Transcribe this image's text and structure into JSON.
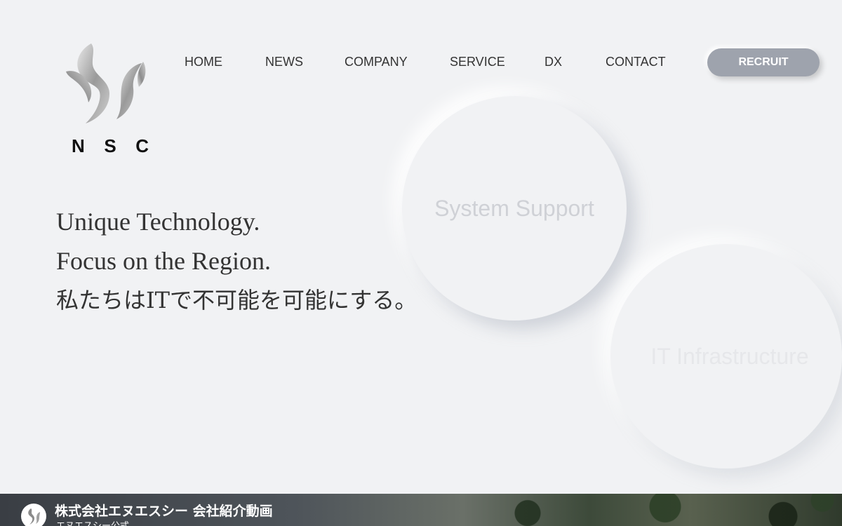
{
  "brand": {
    "logo_text": [
      "N",
      "S",
      "C"
    ],
    "logo_icon": "swirl-logo-icon"
  },
  "nav": {
    "items": [
      {
        "label": "HOME"
      },
      {
        "label": "NEWS"
      },
      {
        "label": "COMPANY"
      },
      {
        "label": "SERVICE"
      },
      {
        "label": "DX"
      },
      {
        "label": "CONTACT"
      }
    ],
    "cta_label": "RECRUIT"
  },
  "hero": {
    "line1": "Unique Technology.",
    "line2": "Focus on the Region.",
    "line3": "私たちはITで不可能を可能にする。"
  },
  "services": [
    {
      "label": "System Support"
    },
    {
      "label": "IT Infrastructure"
    }
  ],
  "video": {
    "title": "株式会社エヌエスシー 会社紹介動画",
    "channel": "エヌエスシー公式"
  },
  "colors": {
    "background": "#f1f2f4",
    "cta_bg": "#9ea3ad",
    "text": "#333333"
  }
}
